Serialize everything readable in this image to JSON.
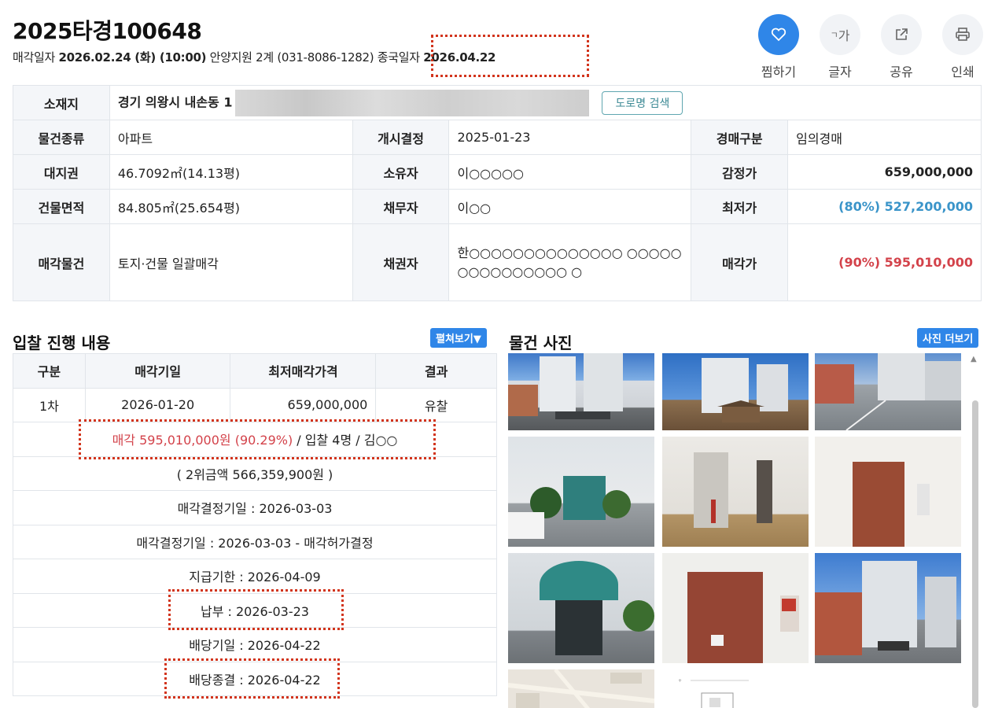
{
  "header": {
    "case_no": "2025타경100648",
    "sale_label": "매각일자 ",
    "sale_date": "2026.02.24 (화) (10:00)",
    "court": " 안양지원 2계 (031-8086-1282)",
    "end_label": " 종국일자 ",
    "end_date": "2026.04.22"
  },
  "actions": [
    {
      "label": "찜하기",
      "icon": "heart-icon"
    },
    {
      "label": "글자",
      "icon": "text-size-icon"
    },
    {
      "label": "공유",
      "icon": "share-icon"
    },
    {
      "label": "인쇄",
      "icon": "print-icon"
    }
  ],
  "text_size_glyph": "가",
  "info": {
    "address_label": "소재지",
    "address_value": "경기 의왕시 내손동 1",
    "road_btn": "도로명 검색",
    "rows": [
      {
        "l1": "물건종류",
        "v1": "아파트",
        "l2": "개시결정",
        "v2": "2025-01-23",
        "l3": "경매구분",
        "v3": "임의경매"
      },
      {
        "l1": "대지권",
        "v1": "46.7092㎡(14.13평)",
        "l2": "소유자",
        "v2": "이○○○○○",
        "l3": "감정가",
        "v3": "659,000,000"
      },
      {
        "l1": "건물면적",
        "v1": "84.805㎡(25.654평)",
        "l2": "채무자",
        "v2": "이○○",
        "l3": "최저가",
        "v3": "(80%) 527,200,000"
      },
      {
        "l1": "매각물건",
        "v1": "토지·건물 일괄매각",
        "l2": "채권자",
        "v2": "한○○○○○○○○○○○○○○ ○○○○○○○○○○○○○○○ ○",
        "l3": "매각가",
        "v3": "(90%) 595,010,000"
      }
    ]
  },
  "bids": {
    "title": "입찰 진행 내용",
    "expand": "펼쳐보기▼",
    "headers": [
      "구분",
      "매각기일",
      "최저매각가격",
      "결과"
    ],
    "row": {
      "round": "1차",
      "date": "2026-01-20",
      "price": "659,000,000",
      "result": "유찰"
    },
    "sale_red": "매각 595,010,000원 (90.29%)",
    "sale_rest": " / 입찰 4명 / 김○○",
    "second": "( 2위금액 566,359,900원 )",
    "events": [
      "매각결정기일 : 2026-03-03",
      "매각결정기일 : 2026-03-03 - 매각허가결정",
      "지급기한 : 2026-04-09",
      "납부 : 2026-03-23",
      "배당기일 : 2026-04-22",
      "배당종결 : 2026-04-22"
    ]
  },
  "photos": {
    "title": "물건 사진",
    "more": "사진 더보기"
  },
  "colors": {
    "accent": "#2f86e8",
    "min_price": "#3a94c9",
    "sale_price": "#d3424a",
    "highlight": "#d2341c"
  }
}
